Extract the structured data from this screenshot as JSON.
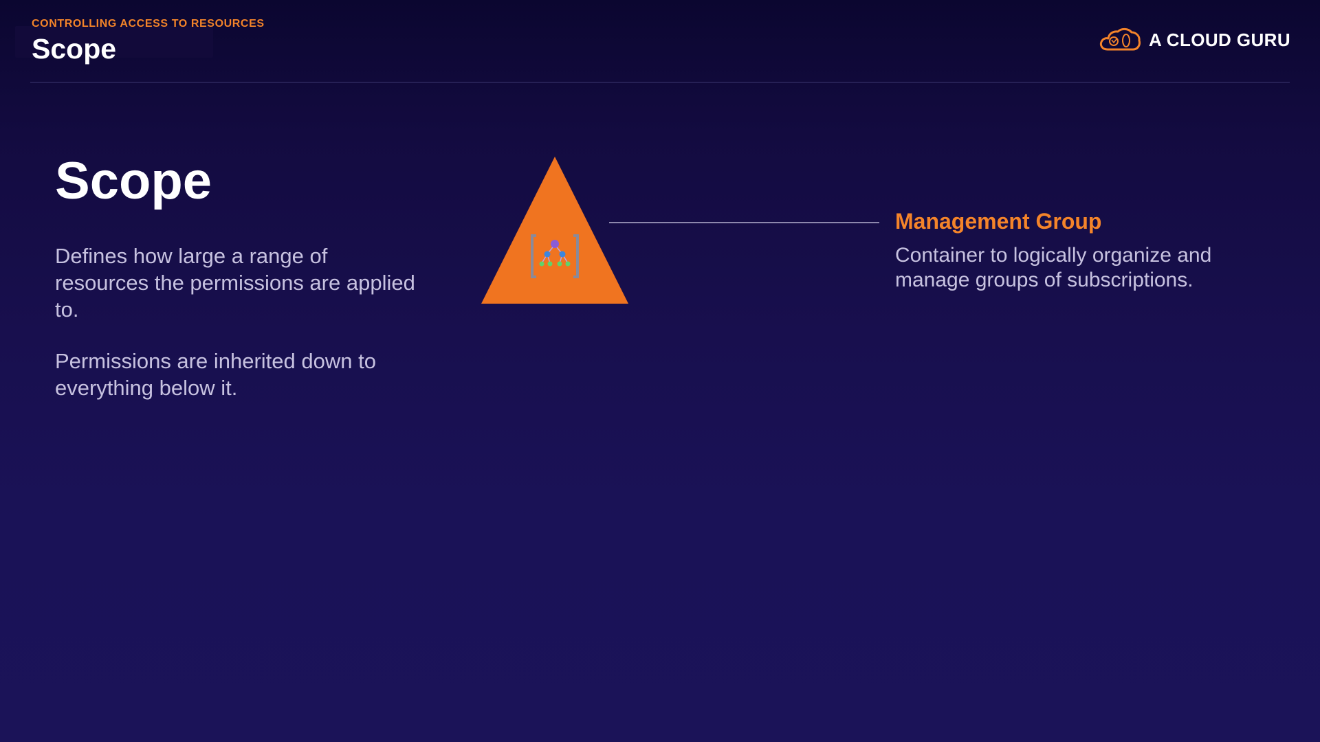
{
  "header": {
    "eyebrow": "CONTROLLING ACCESS TO RESOURCES",
    "title": "Scope",
    "brand_name": "A CLOUD GURU",
    "brand_icon": "cloud-logo-icon"
  },
  "main": {
    "heading": "Scope",
    "paragraphs": [
      "Defines how large a range of resources the permissions are applied to.",
      "Permissions are inherited down to everything below it."
    ]
  },
  "diagram": {
    "icon": "management-group-icon",
    "levels": [
      {
        "label": "Management Group",
        "description": "Container to logically organize and manage groups of subscriptions."
      }
    ]
  },
  "colors": {
    "accent": "#f4842a",
    "background": "#1a1257",
    "text_muted": "#c7c2e0",
    "connector": "#8d88ad"
  }
}
